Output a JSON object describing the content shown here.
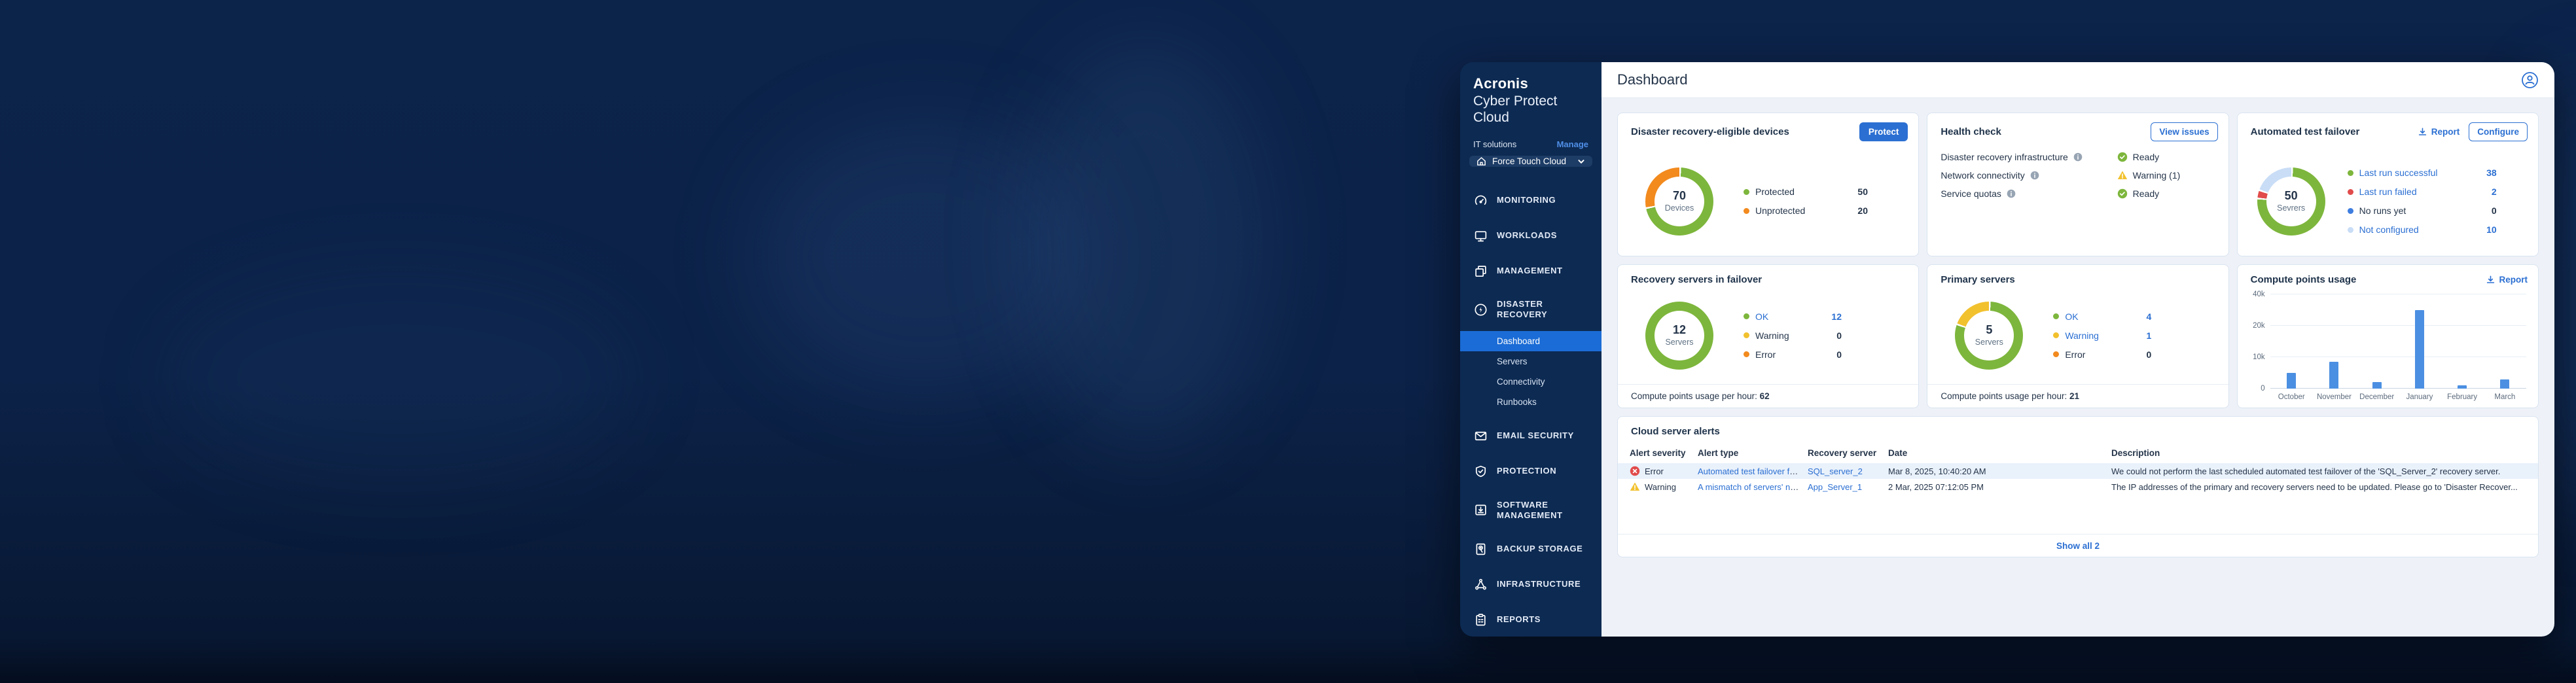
{
  "colors": {
    "accent": "#2b6fd2",
    "green": "#7db63c",
    "orange": "#f28a1e",
    "red": "#e14b4b",
    "yellow": "#f2c12e",
    "light_blue": "#c9ddf6",
    "blue_dot": "#3e7de0",
    "bar": "#4b8fe2"
  },
  "sidebar": {
    "brand_line1": "Acronis",
    "brand_line2": "Cyber Protect Cloud",
    "org_label": "IT solutions",
    "manage_link": "Manage",
    "tenant_selector": {
      "label": "Force Touch Cloud"
    },
    "menu": [
      {
        "label": "MONITORING",
        "icon": "gauge"
      },
      {
        "label": "WORKLOADS",
        "icon": "monitor"
      },
      {
        "label": "MANAGEMENT",
        "icon": "windows"
      },
      {
        "label": "DISASTER RECOVERY",
        "icon": "bolt-circle"
      },
      {
        "label": "Dashboard",
        "sub": true,
        "active": true
      },
      {
        "label": "Servers",
        "sub": true
      },
      {
        "label": "Connectivity",
        "sub": true
      },
      {
        "label": "Runbooks",
        "sub": true
      },
      {
        "label": "EMAIL SECURITY",
        "icon": "envelope",
        "gap_before": true
      },
      {
        "label": "PROTECTION",
        "icon": "shield-check"
      },
      {
        "label": "SOFTWARE MANAGEMENT",
        "icon": "box-download"
      },
      {
        "label": "BACKUP STORAGE",
        "icon": "drive"
      },
      {
        "label": "INFRASTRUCTURE",
        "icon": "nodes"
      },
      {
        "label": "REPORTS",
        "icon": "clipboard"
      }
    ]
  },
  "header": {
    "title": "Dashboard"
  },
  "cards": {
    "eligible_devices": {
      "title": "Disaster recovery-eligible devices",
      "button": "Protect",
      "donut": {
        "center_value": "70",
        "center_label": "Devices",
        "segments": [
          {
            "value": 50,
            "color": "#7db63c"
          },
          {
            "value": 20,
            "color": "#f28a1e"
          }
        ]
      },
      "legend": [
        {
          "label": "Protected",
          "value": "50",
          "dot": "#7db63c",
          "link": false
        },
        {
          "label": "Unprotected",
          "value": "20",
          "dot": "#f28a1e",
          "link": false
        }
      ]
    },
    "health_check": {
      "title": "Health check",
      "button": "View issues",
      "rows": [
        {
          "label": "Disaster recovery infrastructure",
          "status": "Ready",
          "status_type": "ok"
        },
        {
          "label": "Network connectivity",
          "status": "Warning (1)",
          "status_type": "warning"
        },
        {
          "label": "Service quotas",
          "status": "Ready",
          "status_type": "ok"
        }
      ]
    },
    "test_failover": {
      "title": "Automated test failover",
      "report_link": "Report",
      "button": "Configure",
      "donut": {
        "center_value": "50",
        "center_label": "Sevrers",
        "segments": [
          {
            "value": 38,
            "color": "#7db63c"
          },
          {
            "value": 2,
            "color": "#e14b4b"
          },
          {
            "value": 10,
            "color": "#c9ddf6"
          }
        ]
      },
      "legend": [
        {
          "label": "Last run successful",
          "value": "38",
          "dot": "#7db63c",
          "link": true
        },
        {
          "label": "Last run failed",
          "value": "2",
          "dot": "#e14b4b",
          "link": true
        },
        {
          "label": "No runs yet",
          "value": "0",
          "dot": "#3e7de0",
          "link": false
        },
        {
          "label": "Not configured",
          "value": "10",
          "dot": "#c9ddf6",
          "link": true
        }
      ]
    },
    "recovery_servers": {
      "title": "Recovery servers in failover",
      "donut": {
        "center_value": "12",
        "center_label": "Servers",
        "segments": [
          {
            "value": 12,
            "color": "#7db63c"
          }
        ]
      },
      "legend": [
        {
          "label": "OK",
          "value": "12",
          "dot": "#7db63c",
          "link": true
        },
        {
          "label": "Warning",
          "value": "0",
          "dot": "#f2c12e",
          "link": false
        },
        {
          "label": "Error",
          "value": "0",
          "dot": "#f28a1e",
          "link": false
        }
      ],
      "footer_label": "Compute points usage per hour:",
      "footer_value": "62"
    },
    "primary_servers": {
      "title": "Primary servers",
      "donut": {
        "center_value": "5",
        "center_label": "Servers",
        "segments": [
          {
            "value": 4,
            "color": "#7db63c"
          },
          {
            "value": 1,
            "color": "#f2c12e"
          }
        ]
      },
      "legend": [
        {
          "label": "OK",
          "value": "4",
          "dot": "#7db63c",
          "link": true
        },
        {
          "label": "Warning",
          "value": "1",
          "dot": "#f2c12e",
          "link": true
        },
        {
          "label": "Error",
          "value": "0",
          "dot": "#f28a1e",
          "link": false
        }
      ],
      "footer_label": "Compute points usage per hour:",
      "footer_value": "21"
    },
    "compute_points": {
      "title": "Compute points usage",
      "report_link": "Report"
    }
  },
  "chart_data": {
    "type": "bar",
    "title": "Compute points usage",
    "categories": [
      "October",
      "November",
      "December",
      "January",
      "February",
      "March"
    ],
    "values": [
      5000,
      8500,
      2000,
      30000,
      1000,
      3000
    ],
    "bar_color": "#4b8fe2",
    "ytick_labels": [
      "0",
      "10k",
      "20k",
      "40k"
    ],
    "ytick_values": [
      0,
      10000,
      20000,
      40000
    ],
    "grid": true,
    "legend_position": "none"
  },
  "alerts": {
    "title": "Cloud server alerts",
    "columns": [
      "Alert severity",
      "Alert type",
      "Recovery server",
      "Date",
      "Description"
    ],
    "rows": [
      {
        "severity": "Error",
        "severity_type": "error",
        "type": "Automated test failover failed",
        "server": "SQL_server_2",
        "date": "Mar 8, 2025, 10:40:20 AM",
        "description": "We could not perform the last scheduled automated test failover of the 'SQL_Server_2' recovery server.",
        "highlighted": true
      },
      {
        "severity": "Warning",
        "severity_type": "warning",
        "type": "A mismatch of servers' network...",
        "server": "App_Server_1",
        "date": "2 Mar, 2025 07:12:05 PM",
        "description": "The IP addresses of the primary and recovery servers need to be updated. Please go to 'Disaster Recover...",
        "highlighted": false
      }
    ],
    "show_all": "Show all 2"
  }
}
